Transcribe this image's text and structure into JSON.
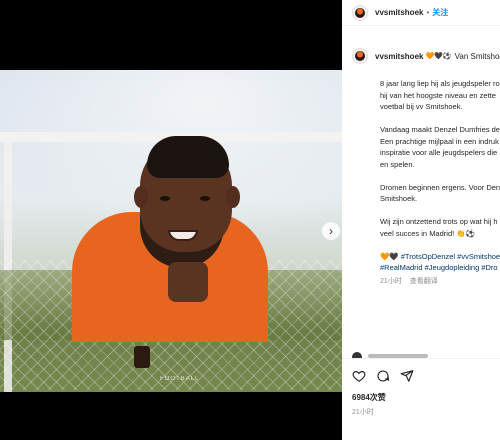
{
  "header": {
    "username": "vvsmitshoek",
    "separator": "•",
    "follow_label": "关注"
  },
  "comment": {
    "username": "vvsmitshoek",
    "club_emojis": "🧡🖤⚽",
    "club_name": "Van Smitshoek",
    "caption_lines": [
      "8 jaar lang liep hij als jeugdspeler ro",
      "hij van het hoogste niveau en zette",
      "voetbal bij vv Smitshoek.",
      "",
      "Vandaag maakt Denzel Dumfries de",
      "Een prachtige mijlpaal in een indruk",
      "inspiratie voor alle jeugdspelers die",
      "en spelen.",
      "",
      "Dromen beginnen ergens. Voor Den",
      "Smitshoek.",
      "",
      "Wij zijn ontzettend trots op wat hij h",
      "veel succes in Madrid! 👏⚽"
    ],
    "hashtags_lines": [
      "🧡🖤 #TrotsOpDenzel #vvSmitshoe",
      "#RealMadrid #Jeugdopleiding #Dro"
    ],
    "time": "21小时",
    "see_translation": "查看翻译"
  },
  "actions": {
    "like_icon": "heart-icon",
    "comment_icon": "comment-icon",
    "share_icon": "share-icon",
    "likes": "6984次赞",
    "time": "21小时"
  },
  "media": {
    "next_icon": "chevron-right-icon",
    "shirt_text": "FOOTBALL"
  },
  "colors": {
    "link": "#0095f6",
    "hashtag": "#00376b",
    "shirt": "#e8651f"
  }
}
